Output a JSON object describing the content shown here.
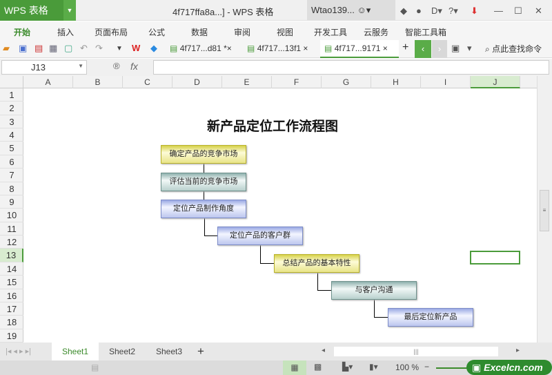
{
  "app": {
    "name": "WPS 表格",
    "window_title": "4f717ffa8a...] - WPS 表格",
    "user": "Wtao139..."
  },
  "menu": [
    "开始",
    "插入",
    "页面布局",
    "公式",
    "数据",
    "审阅",
    "视图",
    "开发工具",
    "云服务",
    "智能工具箱"
  ],
  "doc_tabs": [
    "4f717...d81 *",
    "4f717...13f1",
    "4f717...9171"
  ],
  "search_cmd": "点此查找命令",
  "name_box": "J13",
  "fx_label": "fx",
  "columns": [
    "A",
    "B",
    "C",
    "D",
    "E",
    "F",
    "G",
    "H",
    "I",
    "J"
  ],
  "rows": [
    "1",
    "2",
    "3",
    "4",
    "5",
    "6",
    "7",
    "8",
    "9",
    "10",
    "11",
    "12",
    "13",
    "14",
    "15",
    "16",
    "17",
    "18",
    "19"
  ],
  "flow": {
    "title": "新产品定位工作流程图",
    "steps": [
      "确定产品的竞争市场",
      "评估当前的竞争市场",
      "定位产品制作角度",
      "定位产品的客户群",
      "总结产品的基本特性",
      "与客户沟通",
      "最后定位新产品"
    ]
  },
  "sheets": [
    "Sheet1",
    "Sheet2",
    "Sheet3"
  ],
  "status": {
    "zoom": "100 %"
  },
  "watermark": "Excelcn.com",
  "colors": {
    "accent": "#4a9b3a"
  }
}
